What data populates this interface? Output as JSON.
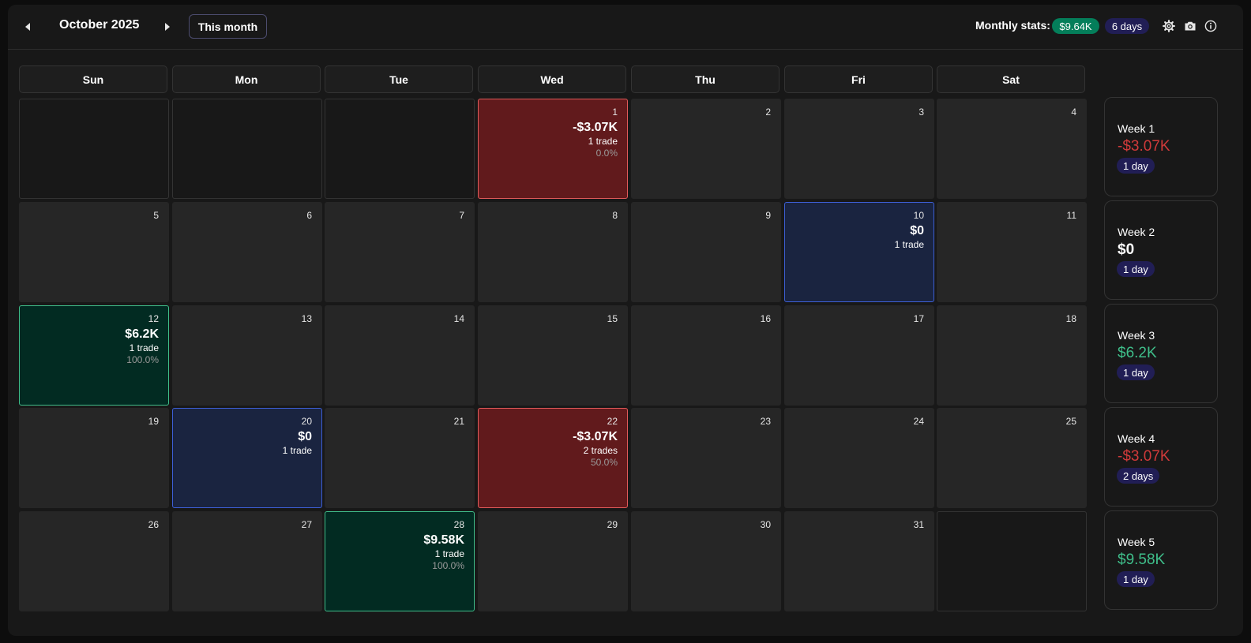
{
  "header": {
    "month_title": "October 2025",
    "this_month_label": "This month",
    "stats_label": "Monthly stats:",
    "stats_pnl": "$9.64K",
    "stats_days": "6 days"
  },
  "icons": {
    "prev": "caret-left-icon",
    "next": "caret-right-icon",
    "settings": "gear-icon",
    "camera": "camera-icon",
    "info": "info-icon"
  },
  "colors": {
    "loss_bg": "#611a1c",
    "gain_bg": "#022b22",
    "even_bg": "#1a2440",
    "stats_green": "#047e5a",
    "stats_purple": "#211e55"
  },
  "weekdays": [
    "Sun",
    "Mon",
    "Tue",
    "Wed",
    "Thu",
    "Fri",
    "Sat"
  ],
  "days": {
    "d1": {
      "num": "1",
      "pnl": "-$3.07K",
      "trades": "1 trade",
      "pct": "0.0%"
    },
    "d2": {
      "num": "2"
    },
    "d3": {
      "num": "3"
    },
    "d4": {
      "num": "4"
    },
    "d5": {
      "num": "5"
    },
    "d6": {
      "num": "6"
    },
    "d7": {
      "num": "7"
    },
    "d8": {
      "num": "8"
    },
    "d9": {
      "num": "9"
    },
    "d10": {
      "num": "10",
      "pnl": "$0",
      "trades": "1 trade"
    },
    "d11": {
      "num": "11"
    },
    "d12": {
      "num": "12",
      "pnl": "$6.2K",
      "trades": "1 trade",
      "pct": "100.0%"
    },
    "d13": {
      "num": "13"
    },
    "d14": {
      "num": "14"
    },
    "d15": {
      "num": "15"
    },
    "d16": {
      "num": "16"
    },
    "d17": {
      "num": "17"
    },
    "d18": {
      "num": "18"
    },
    "d19": {
      "num": "19"
    },
    "d20": {
      "num": "20",
      "pnl": "$0",
      "trades": "1 trade"
    },
    "d21": {
      "num": "21"
    },
    "d22": {
      "num": "22",
      "pnl": "-$3.07K",
      "trades": "2 trades",
      "pct": "50.0%"
    },
    "d23": {
      "num": "23"
    },
    "d24": {
      "num": "24"
    },
    "d25": {
      "num": "25"
    },
    "d26": {
      "num": "26"
    },
    "d27": {
      "num": "27"
    },
    "d28": {
      "num": "28",
      "pnl": "$9.58K",
      "trades": "1 trade",
      "pct": "100.0%"
    },
    "d29": {
      "num": "29"
    },
    "d30": {
      "num": "30"
    },
    "d31": {
      "num": "31"
    }
  },
  "weeks": [
    {
      "label": "Week 1",
      "pnl": "-$3.07K",
      "days": "1 day"
    },
    {
      "label": "Week 2",
      "pnl": "$0",
      "days": "1 day"
    },
    {
      "label": "Week 3",
      "pnl": "$6.2K",
      "days": "1 day"
    },
    {
      "label": "Week 4",
      "pnl": "-$3.07K",
      "days": "2 days"
    },
    {
      "label": "Week 5",
      "pnl": "$9.58K",
      "days": "1 day"
    }
  ]
}
